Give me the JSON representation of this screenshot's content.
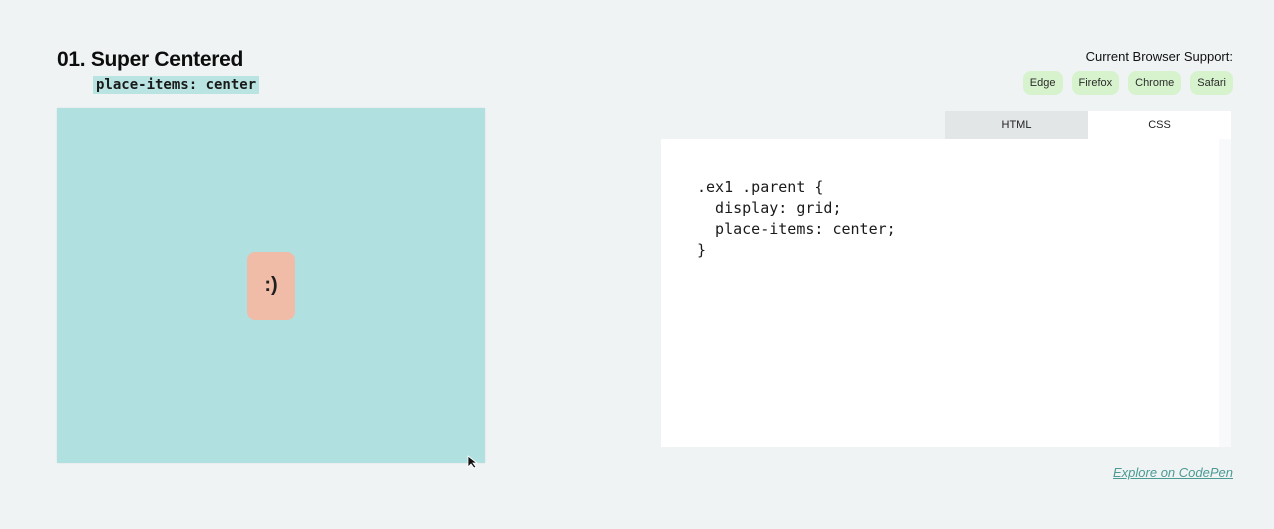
{
  "section": {
    "title": "01. Super Centered",
    "subtitle": "place-items: center"
  },
  "browser_support": {
    "label": "Current Browser Support:",
    "browsers": [
      "Edge",
      "Firefox",
      "Chrome",
      "Safari"
    ]
  },
  "demo": {
    "child_text": ":)"
  },
  "code_tabs": {
    "html_label": "HTML",
    "css_label": "CSS",
    "active": "CSS"
  },
  "code": {
    "css": ".ex1 .parent {\n  display: grid;\n  place-items: center;\n}"
  },
  "link": {
    "codepen": "Explore on CodePen"
  },
  "colors": {
    "background": "#eff3f4",
    "demo_parent": "#b0e0df",
    "demo_child": "#f0bca8",
    "subtitle_highlight": "#b9e4e1",
    "badge": "#d6f3cd",
    "link": "#4c9a93"
  },
  "icons": {
    "cursor": "resize-cursor-icon"
  }
}
